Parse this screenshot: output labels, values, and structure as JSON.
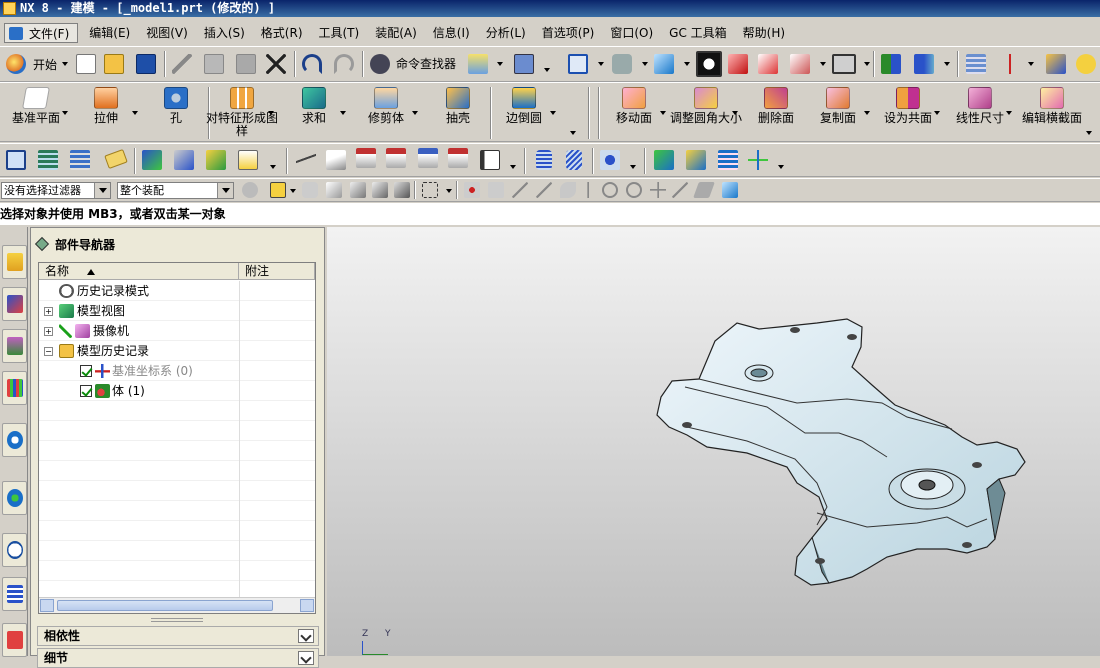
{
  "window": {
    "title": "NX 8 - 建模 - [_model1.prt  (修改的) ]"
  },
  "menu": [
    "文件(F)",
    "编辑(E)",
    "视图(V)",
    "插入(S)",
    "格式(R)",
    "工具(T)",
    "装配(A)",
    "信息(I)",
    "分析(L)",
    "首选项(P)",
    "窗口(O)",
    "GC 工具箱",
    "帮助(H)"
  ],
  "standard_toolbar": {
    "start_label": "开始",
    "command_finder_label": "命令查找器"
  },
  "feature_toolbar": {
    "tools": [
      "基准平面",
      "拉伸",
      "孔",
      "对特征形成图样",
      "求和",
      "修剪体",
      "抽壳",
      "边倒圆"
    ],
    "sync_tools": [
      "移动面",
      "调整圆角大小",
      "删除面",
      "复制面",
      "设为共面",
      "线性尺寸",
      "编辑横截面"
    ]
  },
  "selection_bar": {
    "filter_value": "没有选择过滤器",
    "scope_value": "整个装配"
  },
  "cue_line": "选择对象并使用 MB3，或者双击某一对象",
  "navigator": {
    "title": "部件导航器",
    "columns": {
      "name": "名称",
      "note": "附注"
    },
    "rows": [
      {
        "label": "历史记录模式"
      },
      {
        "label": "模型视图"
      },
      {
        "label": "摄像机"
      },
      {
        "label": "模型历史记录"
      },
      {
        "label": "基准坐标系 (0)"
      },
      {
        "label": "体 (1)"
      }
    ],
    "sections": [
      "相依性",
      "细节"
    ]
  },
  "triad": {
    "z": "Z",
    "y": "Y"
  }
}
